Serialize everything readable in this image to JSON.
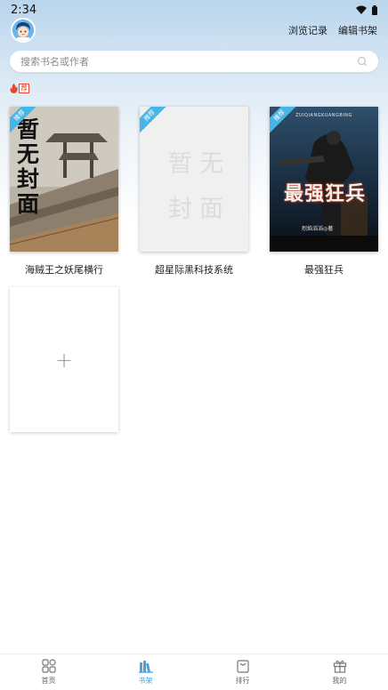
{
  "status": {
    "time": "2:34"
  },
  "header": {
    "links": [
      "浏览记录",
      "编辑书架"
    ]
  },
  "search": {
    "placeholder": "搜索书名或作者"
  },
  "hot_tag": {
    "label": "荐"
  },
  "books": [
    {
      "title": "海贼王之妖尾横行",
      "ribbon": "推荐",
      "cover_text": "暂无封面"
    },
    {
      "title": "超星际黑科技系统",
      "ribbon": "推荐",
      "cover_text": [
        "暂",
        "无",
        "封",
        "面"
      ]
    },
    {
      "title": "最强狂兵",
      "ribbon": "推荐",
      "cover_text": "最强狂兵",
      "cover_subtitle": "ZUIQIANGKUANGBING",
      "cover_author": "烈焰滔滔◎著"
    }
  ],
  "add_card": {
    "symbol": "+"
  },
  "tabs": [
    {
      "label": "首页",
      "icon": "grid-icon"
    },
    {
      "label": "书架",
      "icon": "bookshelf-icon",
      "active": true
    },
    {
      "label": "排行",
      "icon": "ranking-bag-icon"
    },
    {
      "label": "我的",
      "icon": "gift-icon"
    }
  ],
  "colors": {
    "accent": "#4aa3dc",
    "ribbon": "#45b6e8",
    "hot": "#e2462f"
  }
}
